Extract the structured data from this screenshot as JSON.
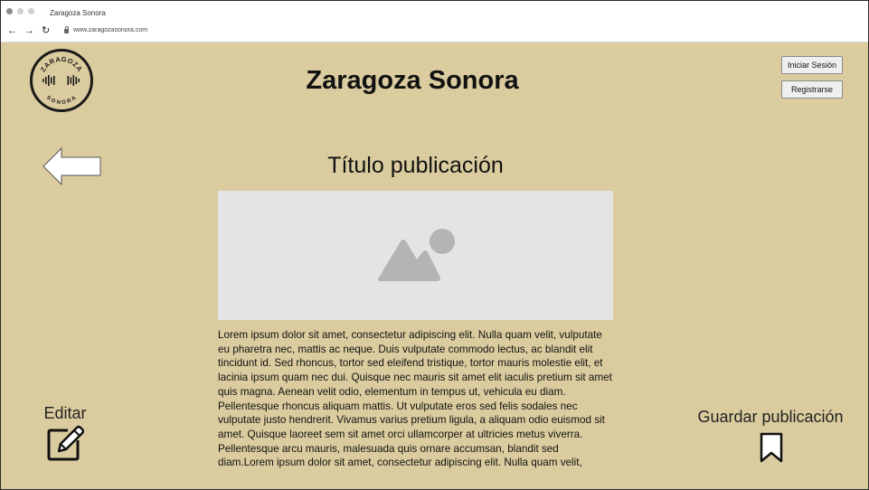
{
  "browser": {
    "tab_title": "Zaragoza Sonora",
    "url": "www.zaragozasonora.com",
    "nav": {
      "back": "←",
      "forward": "→",
      "reload": "↻"
    }
  },
  "header": {
    "logo": {
      "top_text": "ZARAGOZA",
      "bottom_text": "SONORA"
    },
    "site_title": "Zaragoza Sonora",
    "login_label": "Iniciar Sesión",
    "register_label": "Registrarse"
  },
  "post": {
    "title": "Título publicación",
    "image_icon": "image-placeholder-icon",
    "body": "Lorem ipsum dolor sit amet, consectetur adipiscing elit. Nulla quam velit, vulputate eu pharetra nec, mattis ac neque. Duis vulputate commodo lectus, ac blandit elit tincidunt id. Sed rhoncus, tortor sed eleifend tristique, tortor mauris molestie elit, et lacinia ipsum quam nec dui. Quisque nec mauris sit amet elit iaculis pretium sit amet quis magna. Aenean velit odio, elementum in tempus ut, vehicula eu diam. Pellentesque rhoncus aliquam mattis. Ut vulputate eros sed felis sodales nec vulputate justo hendrerit. Vivamus varius pretium ligula, a aliquam odio euismod sit amet. Quisque laoreet sem sit amet orci ullamcorper at ultricies metus viverra. Pellentesque arcu mauris, malesuada quis ornare accumsan, blandit sed diam.Lorem ipsum dolor sit amet, consectetur adipiscing elit. Nulla quam velit,"
  },
  "actions": {
    "edit_label": "Editar",
    "save_label": "Guardar publicación"
  },
  "colors": {
    "page_background": "#dbcc9f",
    "image_placeholder": "#e4e4e4",
    "placeholder_glyph": "#b4b4b4"
  }
}
